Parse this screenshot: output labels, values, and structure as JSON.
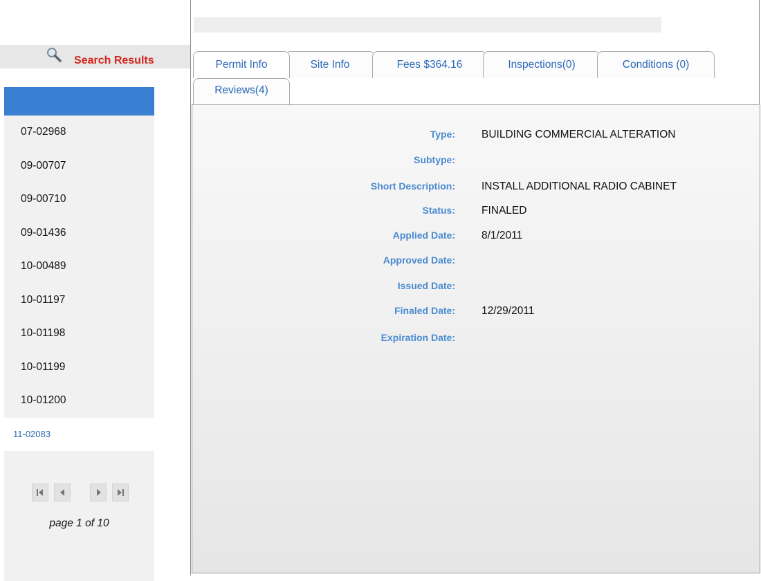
{
  "sidebar": {
    "search_title": "Search Results",
    "results": [
      "07-02968",
      "09-00707",
      "09-00710",
      "09-01436",
      "10-00489",
      "10-01197",
      "10-01198",
      "10-01199",
      "10-01200",
      "11-02083"
    ],
    "selected_index": 9,
    "page_info": "page 1 of 10"
  },
  "tabs": [
    {
      "label": "Permit Info"
    },
    {
      "label": "Site Info"
    },
    {
      "label": "Fees $364.16"
    },
    {
      "label": "Inspections(0)"
    },
    {
      "label": "Conditions (0)"
    },
    {
      "label": "Reviews(4)"
    }
  ],
  "active_tab": "Permit Info",
  "permit": {
    "fields": [
      {
        "label": "Type:",
        "value": "BUILDING COMMERCIAL ALTERATION"
      },
      {
        "label": "Subtype:",
        "value": ""
      },
      {
        "label": "Short Description:",
        "value": "INSTALL ADDITIONAL RADIO CABINET"
      },
      {
        "label": "Status:",
        "value": "FINALED"
      },
      {
        "label": "Applied Date:",
        "value": "8/1/2011"
      },
      {
        "label": "Approved Date:",
        "value": ""
      },
      {
        "label": "Issued Date:",
        "value": ""
      },
      {
        "label": "Finaled Date:",
        "value": "12/29/2011"
      },
      {
        "label": "Expiration Date:",
        "value": ""
      }
    ]
  },
  "colors": {
    "search_title": "#d5251b",
    "accent_blue": "#3a80d2",
    "label_blue": "#4a8ad0",
    "tab_text": "#2a68b8"
  }
}
